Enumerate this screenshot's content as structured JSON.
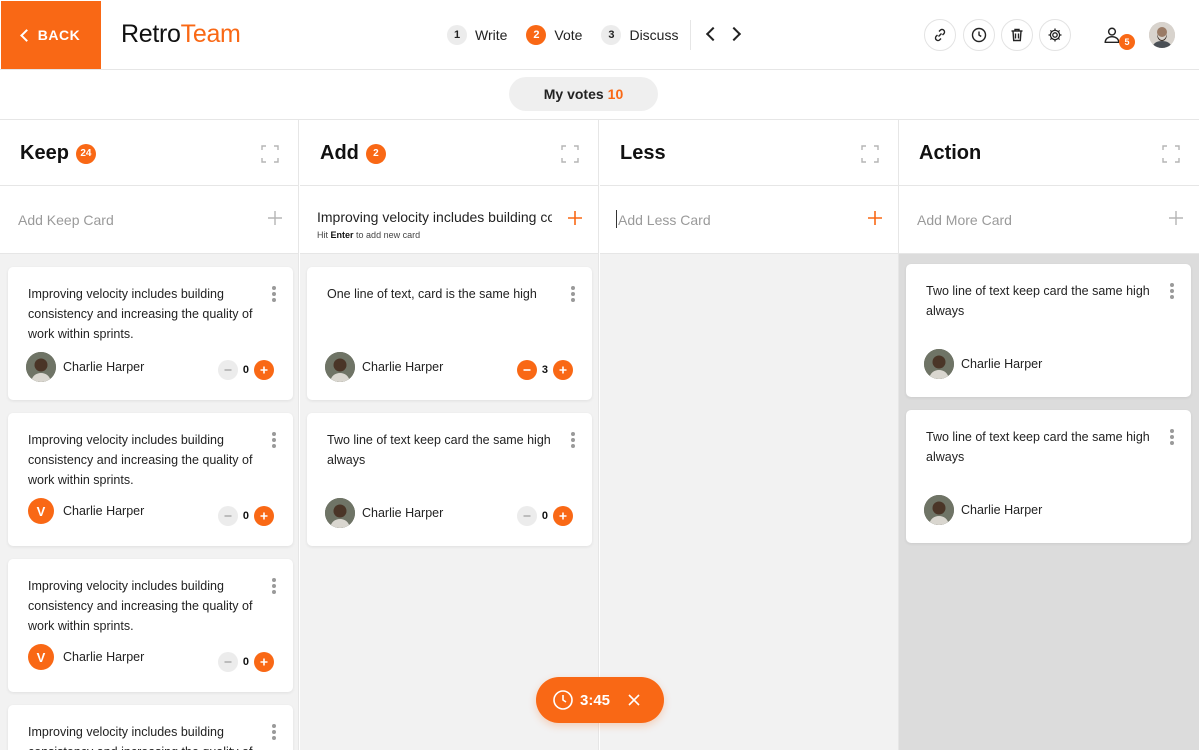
{
  "header": {
    "back_label": "BACK",
    "logo_main": "Retro",
    "logo_accent": "Team",
    "steps": [
      {
        "num": "1",
        "label": "Write"
      },
      {
        "num": "2",
        "label": "Vote"
      },
      {
        "num": "3",
        "label": "Discuss"
      }
    ],
    "users_count": "5"
  },
  "votes": {
    "label": "My votes",
    "count": "10"
  },
  "columns": [
    {
      "title": "Keep",
      "badge": "24",
      "input_placeholder": "Add Keep Card",
      "cards": [
        {
          "text": "Improving velocity includes building consistency and increasing the quality of work within sprints.",
          "author": "Charlie Harper",
          "votes": "0"
        },
        {
          "text": "Improving velocity includes building consistency and increasing the quality of work within sprints.",
          "author": "Charlie Harper",
          "avatar_letter": "V",
          "votes": "0"
        },
        {
          "text": "Improving velocity includes building consistency and increasing the quality of work within sprints.",
          "author": "Charlie Harper",
          "avatar_letter": "V",
          "votes": "0"
        },
        {
          "text": "Improving velocity includes building consistency and increasing the quality of work within sprints."
        }
      ]
    },
    {
      "title": "Add",
      "badge": "2",
      "input_value": "Improving velocity includes building co",
      "input_hint_prefix": "Hit",
      "input_hint_key": "Enter",
      "input_hint_suffix": "to add new card",
      "cards": [
        {
          "text": "One line of text, card is the same high",
          "author": "Charlie Harper",
          "votes": "3"
        },
        {
          "text": "Two line of text keep card the same high always",
          "author": "Charlie Harper",
          "votes": "0"
        }
      ]
    },
    {
      "title": "Less",
      "input_placeholder": "Add Less Card",
      "cards": []
    },
    {
      "title": "Action",
      "input_placeholder": "Add More Card",
      "cards": [
        {
          "text": "Two line of text keep card the same high always",
          "author": "Charlie Harper"
        },
        {
          "text": "Two line of text keep card the same high always",
          "author": "Charlie Harper"
        }
      ]
    }
  ],
  "timer": {
    "time": "3:45"
  },
  "colors": {
    "accent": "#f96815",
    "column_bg": "#f2f2f2",
    "action_bg": "#dcdcdc"
  },
  "icons": [
    "chevron-left-icon",
    "link-icon",
    "clock-icon",
    "trash-icon",
    "gear-icon",
    "user-icon",
    "expand-icon",
    "plus-icon",
    "minus-icon",
    "kebab-icon",
    "close-icon"
  ]
}
